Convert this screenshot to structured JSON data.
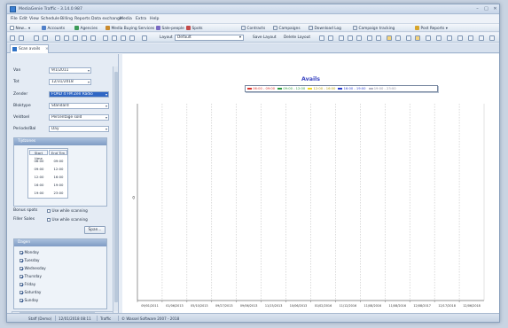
{
  "window": {
    "title": "MediaGenie Traffic - 3.14.0.987"
  },
  "menu": [
    {
      "label": "File"
    },
    {
      "label": "Edit"
    },
    {
      "label": "View"
    },
    {
      "label": "Schedule"
    },
    {
      "label": "Billing"
    },
    {
      "label": "Reports"
    },
    {
      "label": "Data exchange"
    },
    {
      "label": "Media"
    },
    {
      "label": "Extra"
    },
    {
      "label": "Help"
    }
  ],
  "toolbar1": {
    "new": "New...",
    "accounts": "Accounts",
    "agencies": "Agencies",
    "media_buying": "Media Buying Services",
    "salespeople": "Sale-people",
    "spots": "Spots",
    "contracts": "Contracts",
    "campaigns": "Campaigns",
    "download_log": "Download Log",
    "campaign_tracking": "Campaign tracking",
    "post_reports": "Post Reports"
  },
  "toolbar2": {
    "layout_label": "Layout",
    "layout_value": "Default",
    "save_layout": "Save Layout",
    "delete_layout": "Delete Layout"
  },
  "tab": {
    "label": "Scan avails"
  },
  "form": {
    "van_label": "Van",
    "van_value": "9/1/2011",
    "tot_label": "Tot",
    "tot_value": "12/31/2018",
    "zender_label": "Zender",
    "zender_value": "FOAD 4 FM Zen Radio",
    "bloktype_label": "Bloktype",
    "bloktype_value": "Standard",
    "veldtoel_label": "Veldtoel",
    "veldtoel_value": "Percentage sold",
    "periode_label": "Periode/Bal",
    "periode_value": "Day"
  },
  "timezones": {
    "header": "Tijdzones",
    "col_start": "Start time",
    "col_end": "End Tim",
    "rows": [
      {
        "start": "06:00",
        "end": "09:00"
      },
      {
        "start": "09:00",
        "end": "12:00"
      },
      {
        "start": "12:00",
        "end": "16:00"
      },
      {
        "start": "16:00",
        "end": "19:00"
      },
      {
        "start": "19:00",
        "end": "23:00"
      }
    ]
  },
  "options": {
    "bonus_label": "Bonus spots",
    "bonus_check": "Use while scanning",
    "filler_label": "Filler Sales",
    "filler_check": "Use while scanning",
    "scan_button": "Span..."
  },
  "days": {
    "header": "Dagen",
    "items": [
      {
        "label": "Monday",
        "checked": true
      },
      {
        "label": "Tuesday",
        "checked": true
      },
      {
        "label": "Wednesday",
        "checked": true
      },
      {
        "label": "Thursday",
        "checked": true
      },
      {
        "label": "Friday",
        "checked": true
      },
      {
        "label": "Saturday",
        "checked": true
      },
      {
        "label": "Sunday",
        "checked": true
      }
    ]
  },
  "chart_data": {
    "type": "line",
    "title": "Avails",
    "series": [
      {
        "name": "06:00 - 09:00",
        "color": "#d9342b",
        "values": []
      },
      {
        "name": "09:00 - 12:00",
        "color": "#2e9a3f",
        "values": []
      },
      {
        "name": "12:00 - 16:00",
        "color": "#f2d81c",
        "values": []
      },
      {
        "name": "16:00 - 19:00",
        "color": "#2a3fd0",
        "values": []
      },
      {
        "name": "19:00 - 23:00",
        "color": "#b8b8c8",
        "values": []
      }
    ],
    "y_ticks": [
      "0"
    ],
    "x_categories": [
      "09/01/2011",
      "01/06/2013",
      "05/10/2013",
      "09/27/2013",
      "09/06/2013",
      "11/15/2013",
      "10/06/2013",
      "01/02/2016",
      "11/12/2016",
      "11/08/2016",
      "11/08/2016",
      "12/08/2017",
      "12/17/2018",
      "12/06/2018"
    ],
    "grid": "vertical-dashed"
  },
  "status": {
    "user": "Staff (Demo)",
    "datetime": "12/01/2018 08:11",
    "module": "Traffic",
    "copyright": "© Wassel Software 2007 - 2018"
  }
}
